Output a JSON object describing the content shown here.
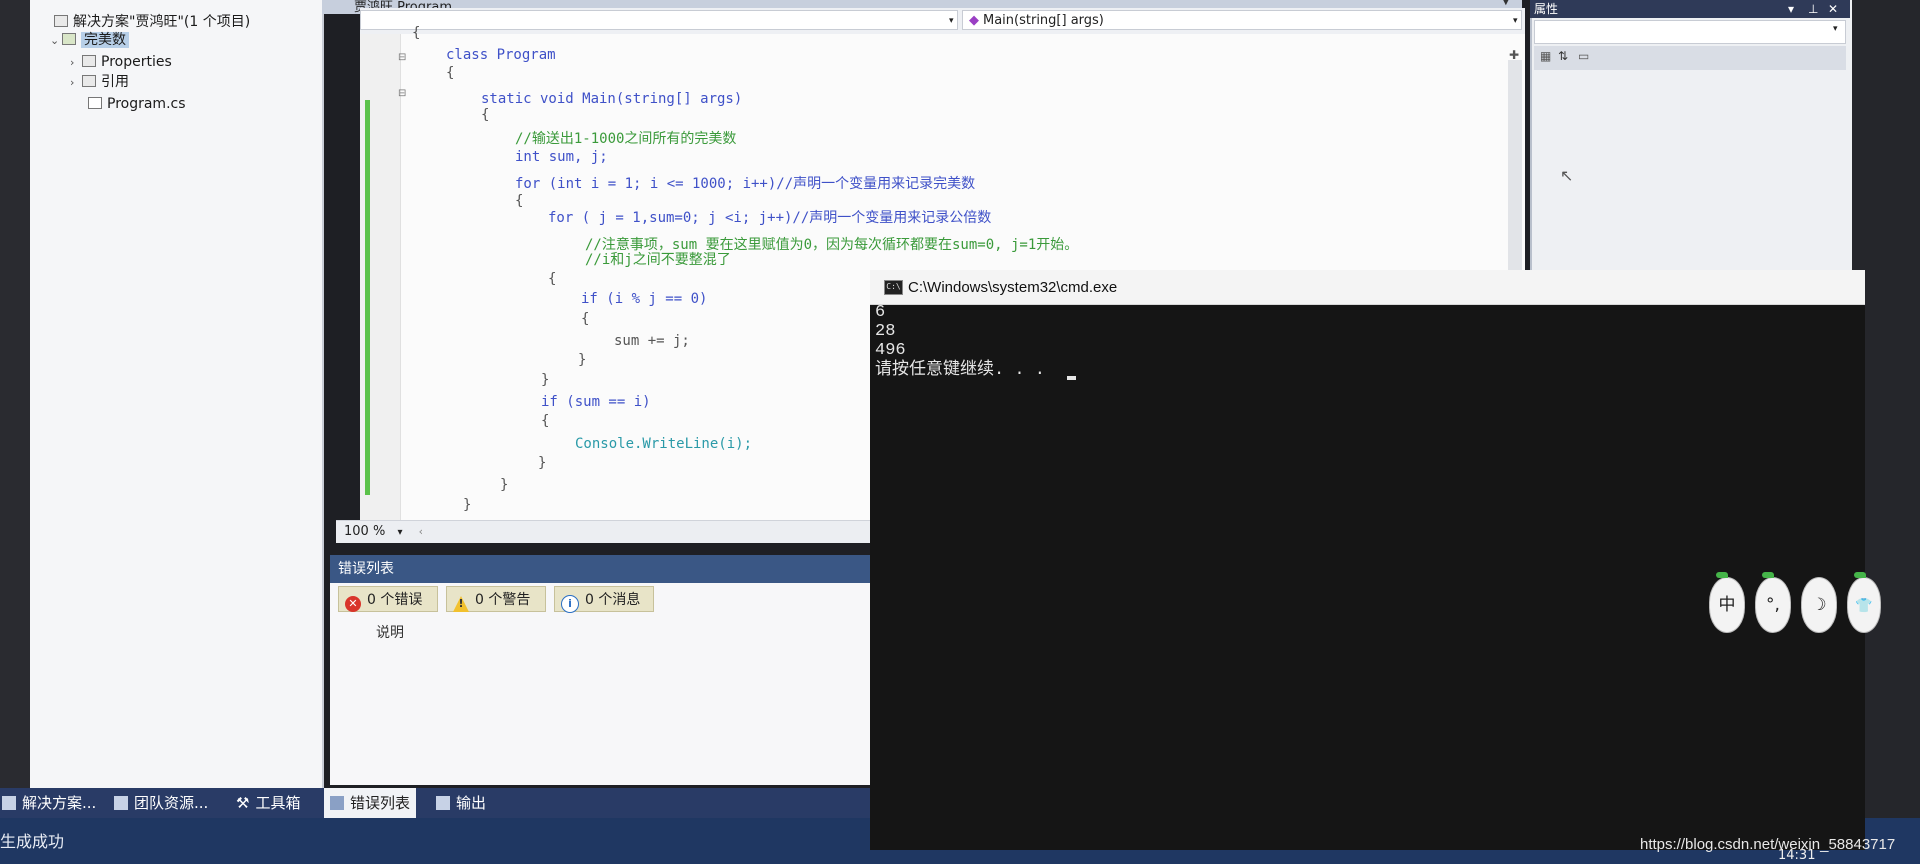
{
  "solution_explorer": {
    "solution_label": "解决方案\"贾鸿旺\"(1 个项目)",
    "project_label": "完美数",
    "items": [
      {
        "label": "Properties"
      },
      {
        "label": "引用"
      },
      {
        "label": "Program.cs"
      }
    ]
  },
  "editor": {
    "tab_title": "贾鸿旺.Program",
    "member_dropdown": "Main(string[] args)",
    "zoom": "100 %",
    "code_lines": [
      "{",
      "class Program",
      "{",
      "static void Main(string[] args)",
      "{",
      "//输送出1-1000之间所有的完美数",
      "int sum, j;",
      "for (int i = 1; i <= 1000; i++)//声明一个变量用来记录完美数",
      "{",
      "for ( j = 1,sum=0; j <i; j++)//声明一个变量用来记录公倍数",
      "//注意事项，sum 要在这里赋值为0，因为每次循环都要在sum=0, j=1开始。",
      "//i和j之间不要整混了",
      "{",
      "if (i % j == 0)",
      "{",
      "sum += j;",
      "}",
      "}",
      "if (sum == i)",
      "{",
      "Console.WriteLine(i);",
      "}",
      "}",
      "}"
    ]
  },
  "properties_panel": {
    "title": "属性"
  },
  "error_list": {
    "title": "错误列表",
    "errors_button": "0 个错误",
    "warnings_button": "0 个警告",
    "messages_button": "0 个消息",
    "column_description": "说明"
  },
  "bottom_tabs": {
    "solution": "解决方案...",
    "team": "团队资源...",
    "toolbox": "工具箱",
    "error_list": "错误列表",
    "output": "输出"
  },
  "status_bar": {
    "text": "生成成功"
  },
  "cmd": {
    "title": "C:\\Windows\\system32\\cmd.exe",
    "output_lines": [
      "6",
      "28",
      "496",
      "请按任意键继续. . . "
    ]
  },
  "ime_toolbar": {
    "mode": "中",
    "punct": "°,",
    "width": "☽",
    "skin": "👕"
  },
  "watermark": "https://blog.csdn.net/weixin_58843717",
  "clock": "14:31",
  "colors": {
    "status_bar": "#1f3762",
    "error_list_header": "#3a5785",
    "cmd_background": "#151515",
    "change_bar": "#5bc24a"
  }
}
